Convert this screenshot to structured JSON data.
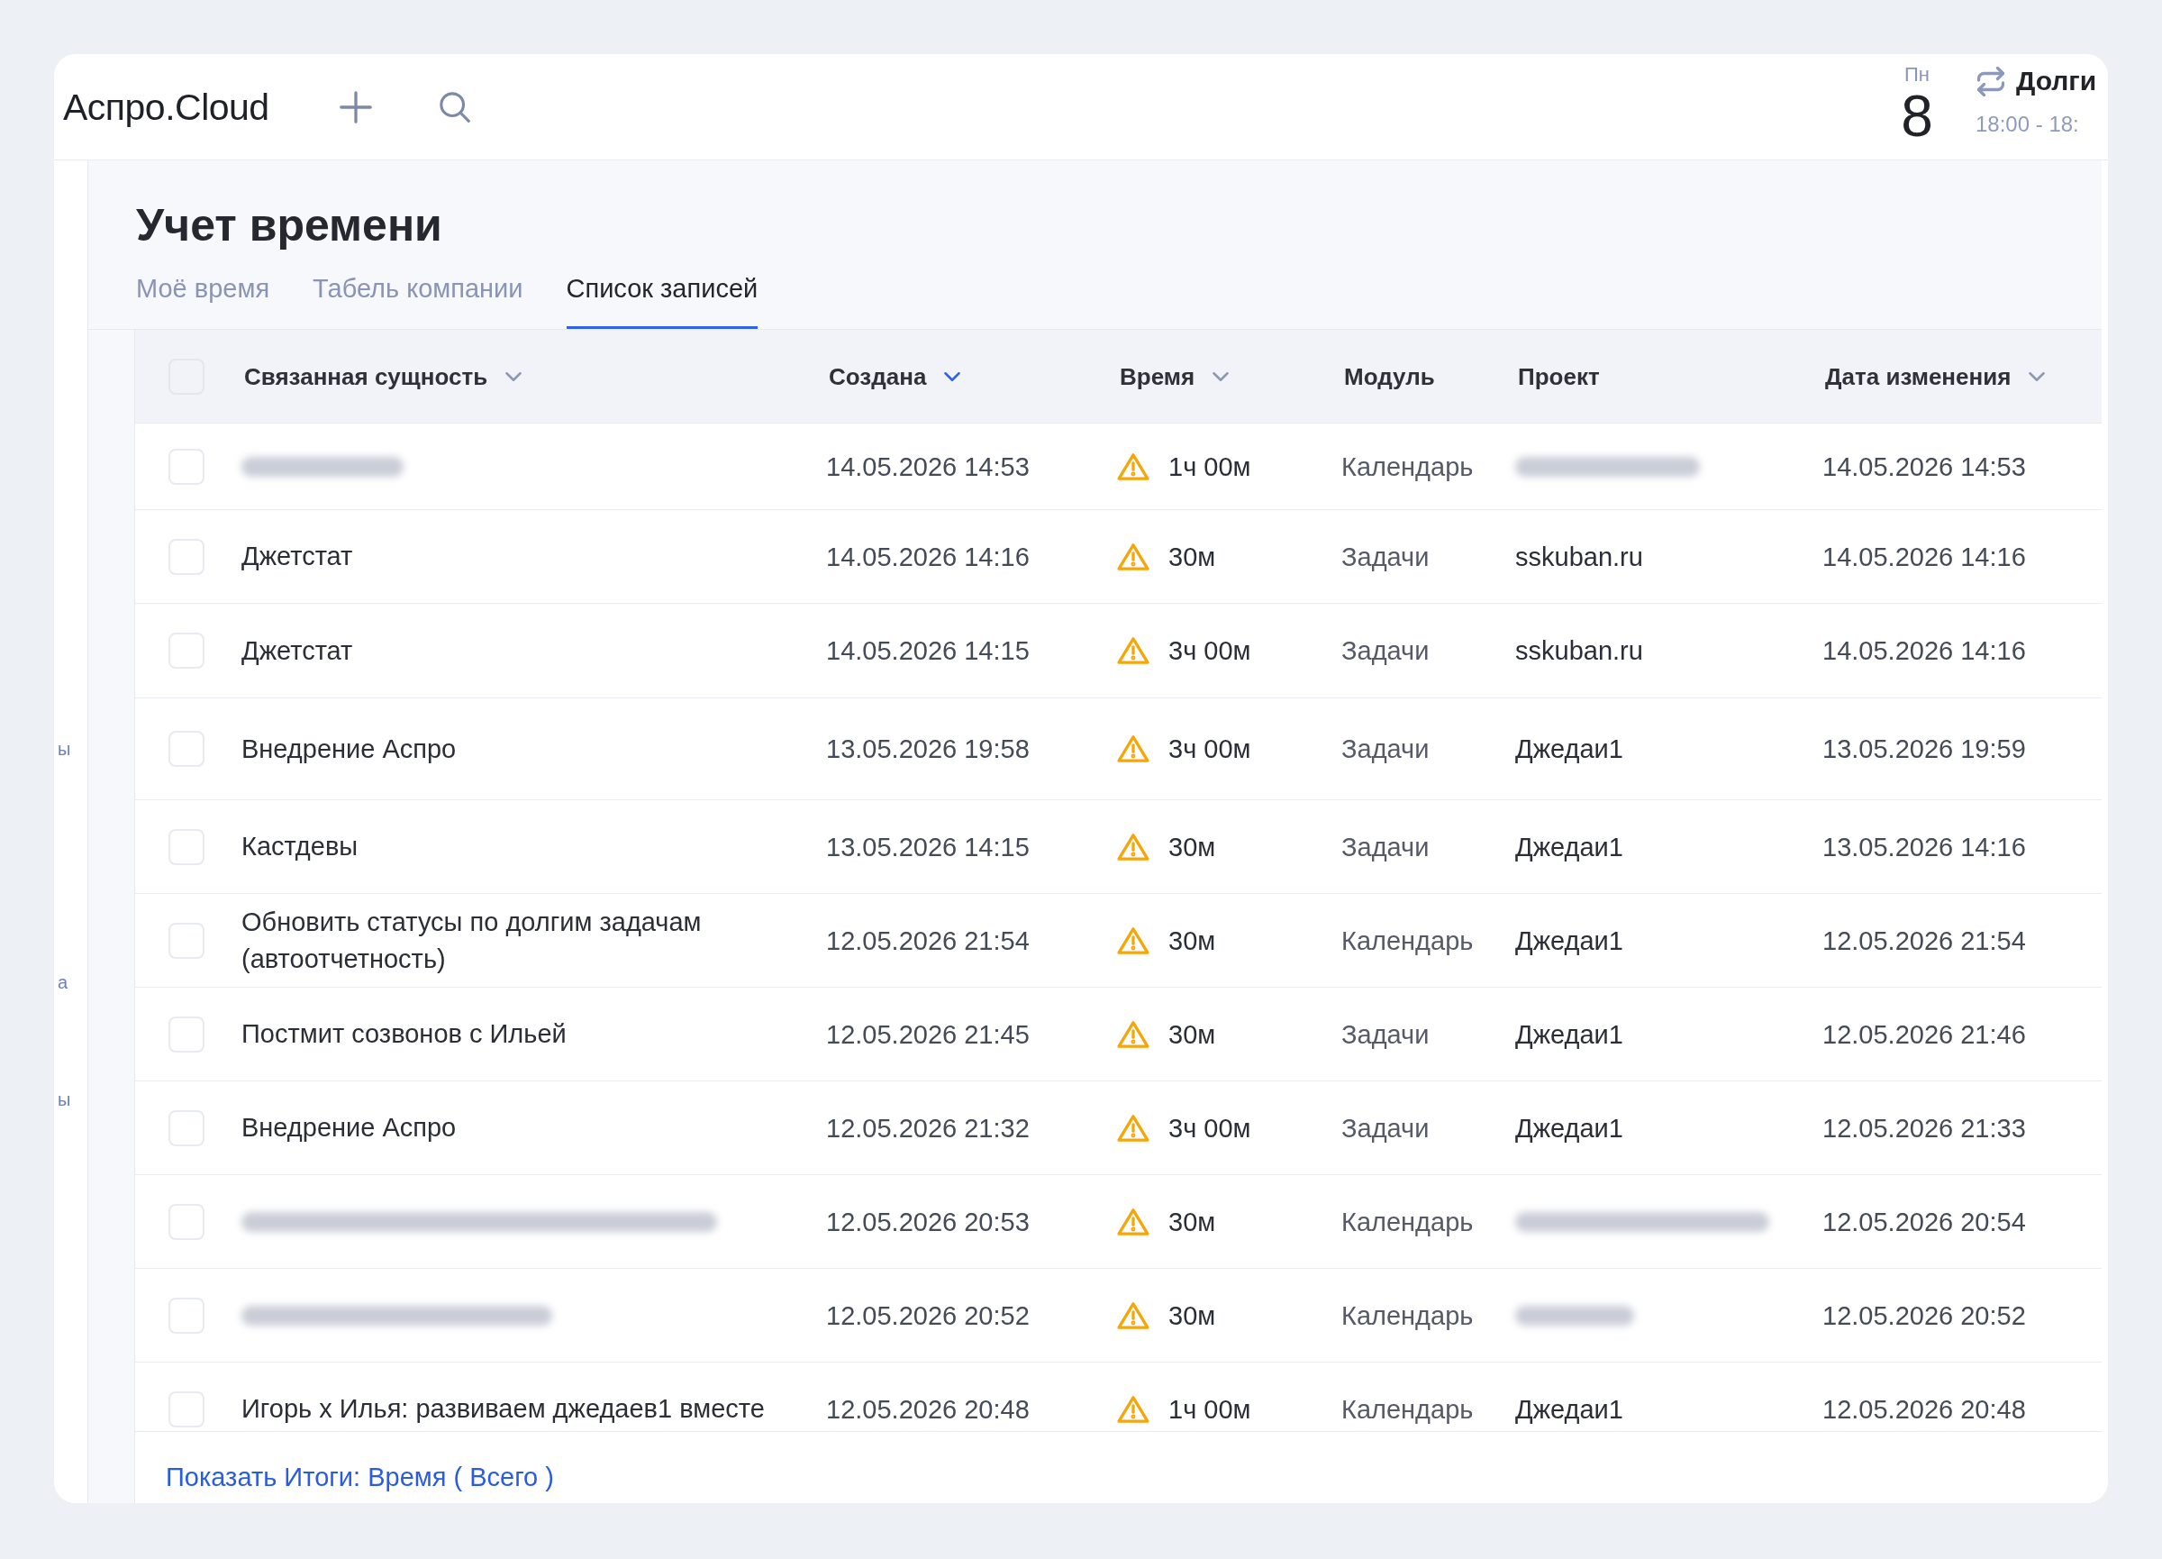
{
  "header": {
    "logo": "Аспро.Cloud",
    "weekday": "Пн",
    "day": "8",
    "event": {
      "title": "Долги",
      "time": "18:00 - 18:"
    }
  },
  "sidebar": {
    "items": [
      {
        "label": "ы"
      },
      {
        "label": "а"
      },
      {
        "label": "ы"
      }
    ]
  },
  "page": {
    "title": "Учет времени",
    "tabs": [
      {
        "label": "Моё время",
        "selected": false
      },
      {
        "label": "Табель компании",
        "selected": false
      },
      {
        "label": "Список записей",
        "selected": true
      }
    ]
  },
  "table": {
    "select_all": {
      "checked": false
    },
    "columns": [
      {
        "label": "Связанная сущность",
        "sortable": true,
        "sorted": false
      },
      {
        "label": "Создана",
        "sortable": true,
        "sorted": true
      },
      {
        "label": "Время",
        "sortable": true,
        "sorted": false
      },
      {
        "label": "Модуль",
        "sortable": false
      },
      {
        "label": "Проект",
        "sortable": false
      },
      {
        "label": "Дата изменения",
        "sortable": true,
        "sorted": false
      }
    ],
    "rows": [
      {
        "checked": false,
        "entity_blurred": true,
        "created": "14.05.2026 14:53",
        "warning": true,
        "time": "1ч 00м",
        "module": "Календарь",
        "project_blurred": true,
        "modified": "14.05.2026 14:53"
      },
      {
        "checked": false,
        "entity_blurred": false,
        "entity": "Джетстат",
        "created": "14.05.2026 14:16",
        "warning": true,
        "time": "30м",
        "module": "Задачи",
        "project_blurred": false,
        "project": "sskuban.ru",
        "modified": "14.05.2026 14:16"
      },
      {
        "checked": false,
        "entity_blurred": false,
        "entity": "Джетстат",
        "created": "14.05.2026 14:15",
        "warning": true,
        "time": "3ч 00м",
        "module": "Задачи",
        "project_blurred": false,
        "project": "sskuban.ru",
        "modified": "14.05.2026 14:16"
      },
      {
        "checked": false,
        "entity_blurred": false,
        "entity": "Внедрение Аспро",
        "created": "13.05.2026 19:58",
        "warning": true,
        "time": "3ч 00м",
        "module": "Задачи",
        "project_blurred": false,
        "project": "Джедаи1",
        "modified": "13.05.2026 19:59"
      },
      {
        "checked": false,
        "entity_blurred": false,
        "entity": "Кастдевы",
        "created": "13.05.2026 14:15",
        "warning": true,
        "time": "30м",
        "module": "Задачи",
        "project_blurred": false,
        "project": "Джедаи1",
        "modified": "13.05.2026 14:16"
      },
      {
        "checked": false,
        "entity_blurred": false,
        "entity": "Обновить статусы по долгим задачам (автоотчетность)",
        "created": "12.05.2026 21:54",
        "warning": true,
        "time": "30м",
        "module": "Календарь",
        "project_blurred": false,
        "project": "Джедаи1",
        "modified": "12.05.2026 21:54"
      },
      {
        "checked": false,
        "entity_blurred": false,
        "entity": "Постмит созвонов с Ильей",
        "created": "12.05.2026 21:45",
        "warning": true,
        "time": "30м",
        "module": "Задачи",
        "project_blurred": false,
        "project": "Джедаи1",
        "modified": "12.05.2026 21:46"
      },
      {
        "checked": false,
        "entity_blurred": false,
        "entity": "Внедрение Аспро",
        "created": "12.05.2026 21:32",
        "warning": true,
        "time": "3ч 00м",
        "module": "Задачи",
        "project_blurred": false,
        "project": "Джедаи1",
        "modified": "12.05.2026 21:33"
      },
      {
        "checked": false,
        "entity_blurred": true,
        "created": "12.05.2026 20:53",
        "warning": true,
        "time": "30м",
        "module": "Календарь",
        "project_blurred": true,
        "modified": "12.05.2026 20:54"
      },
      {
        "checked": false,
        "entity_blurred": true,
        "created": "12.05.2026 20:52",
        "warning": true,
        "time": "30м",
        "module": "Календарь",
        "project_blurred": true,
        "modified": "12.05.2026 20:52"
      },
      {
        "checked": false,
        "entity_blurred": false,
        "entity": "Игорь х Илья: развиваем джедаев1 вместе",
        "created": "12.05.2026 20:48",
        "warning": true,
        "time": "1ч 00м",
        "module": "Календарь",
        "project_blurred": false,
        "project": "Джедаи1",
        "modified": "12.05.2026 20:48"
      }
    ]
  },
  "footer": {
    "link": "Показать Итоги: Время ( Всего )"
  }
}
